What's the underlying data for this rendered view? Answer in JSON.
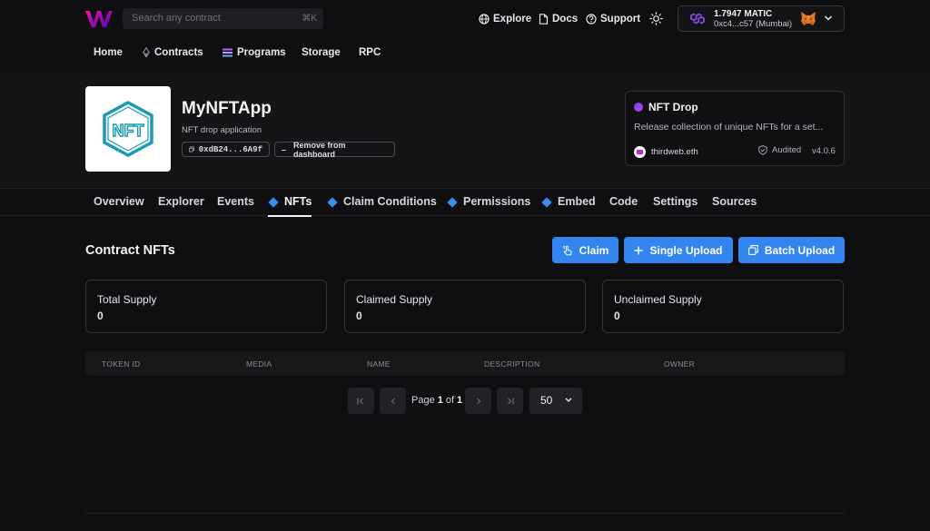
{
  "topbar": {
    "search_placeholder": "Search any contract",
    "search_shortcut": "⌘K",
    "links": [
      {
        "label": "Explore",
        "icon": "globe-icon"
      },
      {
        "label": "Docs",
        "icon": "document-icon"
      },
      {
        "label": "Support",
        "icon": "help-circle-icon"
      }
    ],
    "wallet": {
      "balance": "1.7947 MATIC",
      "address": "0xc4...c57 (Mumbai)"
    }
  },
  "nav": {
    "items": [
      "Home",
      "Contracts",
      "Programs",
      "Storage",
      "RPC"
    ]
  },
  "contract": {
    "name": "MyNFTApp",
    "description": "NFT drop application",
    "address_short": "0xdB24...6A9f",
    "remove_label": "Remove from dashboard",
    "thumbnail_label": "NFT"
  },
  "template_card": {
    "title": "NFT Drop",
    "description": "Release collection of unique NFTs for a set...",
    "author": "thirdweb.eth",
    "audited_label": "Audited",
    "version": "v4.0.6"
  },
  "tabs": [
    {
      "label": "Overview",
      "diamond": false,
      "active": false
    },
    {
      "label": "Explorer",
      "diamond": false,
      "active": false
    },
    {
      "label": "Events",
      "diamond": false,
      "active": false
    },
    {
      "label": "NFTs",
      "diamond": true,
      "active": true
    },
    {
      "label": "Claim Conditions",
      "diamond": true,
      "active": false
    },
    {
      "label": "Permissions",
      "diamond": true,
      "active": false
    },
    {
      "label": "Embed",
      "diamond": true,
      "active": false
    },
    {
      "label": "Code",
      "diamond": false,
      "active": false
    },
    {
      "label": "Settings",
      "diamond": false,
      "active": false
    },
    {
      "label": "Sources",
      "diamond": false,
      "active": false
    }
  ],
  "content": {
    "title": "Contract NFTs",
    "buttons": {
      "claim": "Claim",
      "single_upload": "Single Upload",
      "batch_upload": "Batch Upload"
    },
    "stats": [
      {
        "label": "Total Supply",
        "value": "0"
      },
      {
        "label": "Claimed Supply",
        "value": "0"
      },
      {
        "label": "Unclaimed Supply",
        "value": "0"
      }
    ],
    "table_headers": [
      "TOKEN ID",
      "MEDIA",
      "NAME",
      "DESCRIPTION",
      "OWNER"
    ],
    "pagination": {
      "page_word": "Page",
      "current": "1",
      "of_word": "of",
      "total": "1",
      "page_size": "50"
    }
  },
  "colors": {
    "accent": "#3385f0",
    "background": "#0f0f11",
    "header_bg": "#151517"
  }
}
